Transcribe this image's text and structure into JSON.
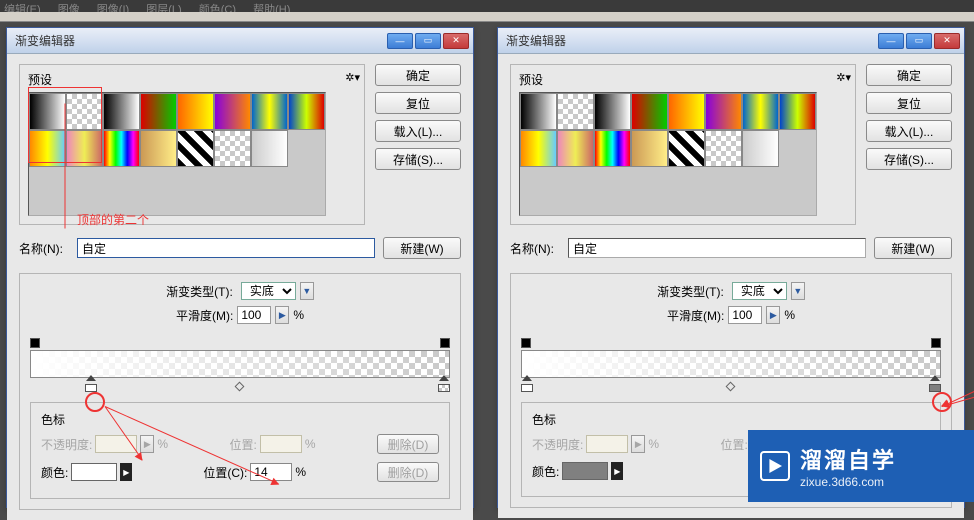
{
  "menubar": {
    "items": [
      "编辑(E)",
      "图像",
      "图像(I)",
      "图层(L)",
      "颜色(C)",
      "帮助(H)"
    ]
  },
  "dialog": {
    "title": "渐变编辑器",
    "presets_label": "预设",
    "buttons": {
      "ok": "确定",
      "reset": "复位",
      "load": "载入(L)...",
      "save": "存储(S)..."
    },
    "name_label": "名称(N):",
    "name_value": "自定",
    "new_btn": "新建(W)",
    "type_label": "渐变类型(T):",
    "type_value": "实底",
    "smooth_label": "平滑度(M):",
    "smooth_value": "100",
    "stops_label": "色标",
    "opacity_label": "不透明度:",
    "pos_label_dim": "位置:",
    "delete_label": "删除(D)",
    "color_label": "颜色:",
    "pos_label": "位置(C):",
    "percent": "%"
  },
  "left": {
    "pos_value": "14",
    "annotation": "顶部的第二个"
  },
  "right": {
    "pos_value": ""
  },
  "watermark": {
    "title": "溜溜自学",
    "url": "zixue.3d66.com"
  },
  "chart_data": null
}
